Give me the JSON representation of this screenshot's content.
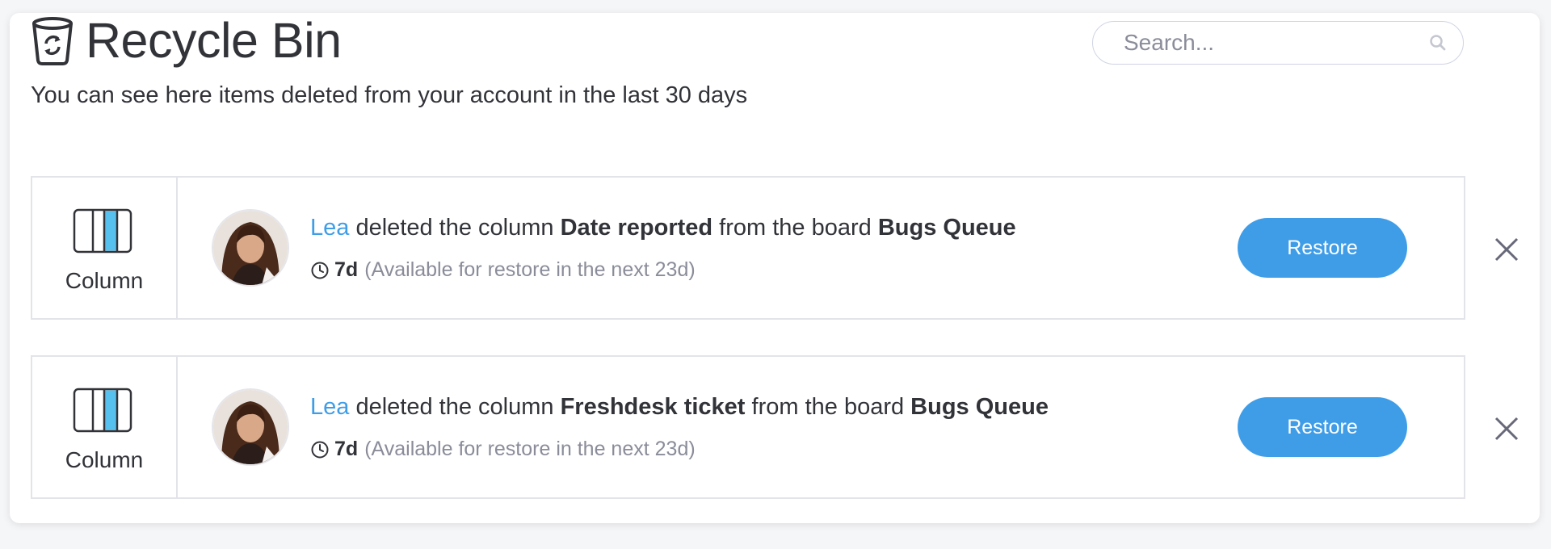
{
  "page": {
    "title": "Recycle Bin",
    "subtitle": "You can see here items deleted from your account in the last 30 days",
    "search_placeholder": "Search...",
    "icons": {
      "bin": "recycle-bin-icon",
      "search": "search-icon",
      "column": "column-icon",
      "clock": "clock-icon",
      "close": "close-icon"
    },
    "colors": {
      "accent": "#3f9de8",
      "text": "#323338",
      "muted": "#8a8c99",
      "border": "#e3e4e9"
    }
  },
  "items": [
    {
      "type_label": "Column",
      "user": "Lea",
      "action": " deleted the column ",
      "item_name": "Date reported",
      "from_text": " from the board ",
      "board": "Bugs Queue",
      "age": "7d",
      "availability": "(Available for restore in the next 23d)",
      "restore_label": "Restore"
    },
    {
      "type_label": "Column",
      "user": "Lea",
      "action": " deleted the column ",
      "item_name": "Freshdesk ticket",
      "from_text": " from the board ",
      "board": "Bugs Queue",
      "age": "7d",
      "availability": "(Available for restore in the next 23d)",
      "restore_label": "Restore"
    }
  ]
}
